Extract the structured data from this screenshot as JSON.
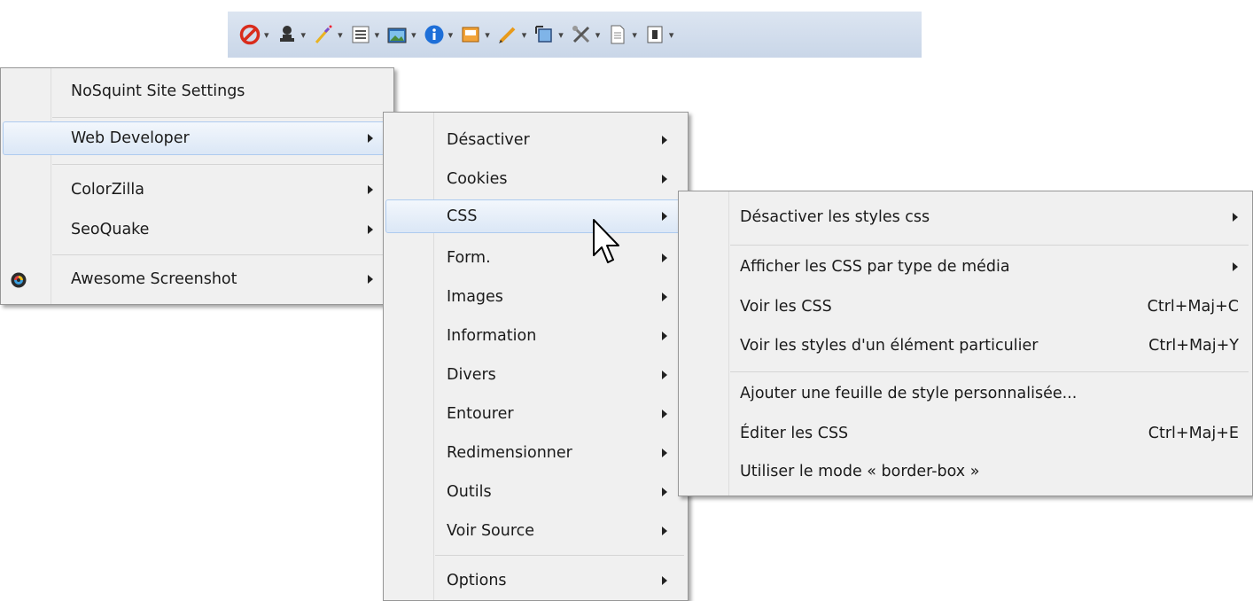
{
  "toolbar": {
    "icons": [
      "disable-icon",
      "user-icon",
      "wand-icon",
      "form-icon",
      "image-icon",
      "info-icon",
      "outline-icon",
      "pencil-icon",
      "resize-icon",
      "tools-icon",
      "source-icon",
      "options-icon"
    ]
  },
  "menu_main": {
    "items": [
      {
        "label": "NoSquint Site Settings"
      },
      {
        "label": "Web Developer"
      },
      {
        "label": "ColorZilla"
      },
      {
        "label": "SeoQuake"
      },
      {
        "label": "Awesome Screenshot"
      }
    ]
  },
  "menu_webdev": {
    "items": [
      {
        "label": "Désactiver"
      },
      {
        "label": "Cookies"
      },
      {
        "label": "CSS"
      },
      {
        "label": "Form."
      },
      {
        "label": "Images"
      },
      {
        "label": "Information"
      },
      {
        "label": "Divers"
      },
      {
        "label": "Entourer"
      },
      {
        "label": "Redimensionner"
      },
      {
        "label": "Outils"
      },
      {
        "label": "Voir Source"
      },
      {
        "label": "Options"
      }
    ]
  },
  "menu_css": {
    "items": [
      {
        "label": "Désactiver les styles css",
        "shortcut": ""
      },
      {
        "label": "Afficher les CSS par type de média",
        "shortcut": ""
      },
      {
        "label": "Voir les CSS",
        "shortcut": "Ctrl+Maj+C"
      },
      {
        "label": "Voir les styles d'un élément particulier",
        "shortcut": "Ctrl+Maj+Y"
      },
      {
        "label": "Ajouter une feuille de style personnalisée...",
        "shortcut": ""
      },
      {
        "label": "Éditer les CSS",
        "shortcut": "Ctrl+Maj+E"
      },
      {
        "label": "Utiliser le mode « border-box »",
        "shortcut": ""
      }
    ]
  },
  "colors": {
    "toolbar_bg": "#d3deee",
    "menu_bg": "#f0f0f0",
    "highlight_border": "#aecbef"
  }
}
